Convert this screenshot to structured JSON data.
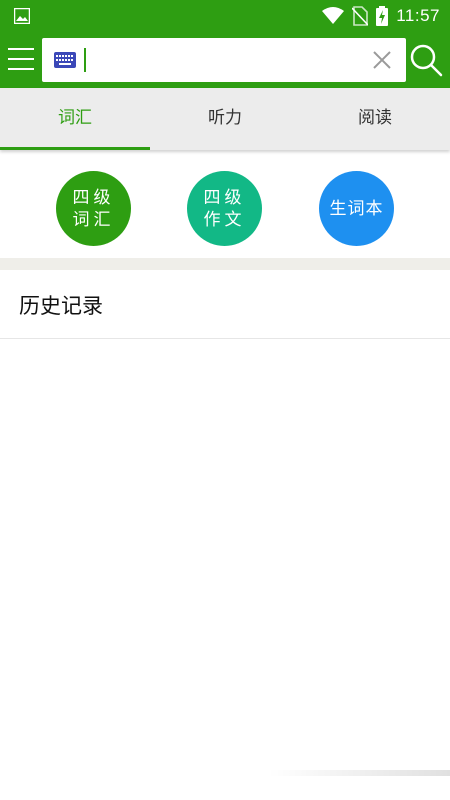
{
  "status_bar": {
    "time": "11:57",
    "icons": [
      "gallery-icon",
      "wifi-icon",
      "no-sim-icon",
      "battery-charging-icon"
    ]
  },
  "app_bar": {
    "search": {
      "value": "",
      "placeholder": ""
    },
    "icons": [
      "menu-icon",
      "keyboard-icon",
      "clear-icon",
      "search-icon"
    ]
  },
  "tabs": [
    {
      "label": "词汇",
      "active": true
    },
    {
      "label": "听力",
      "active": false
    },
    {
      "label": "阅读",
      "active": false
    }
  ],
  "quick_actions": [
    {
      "line1": "四级",
      "line2": "词汇",
      "color": "#2e9e12"
    },
    {
      "line1": "四级",
      "line2": "作文",
      "color": "#12b886"
    },
    {
      "line1": "生词本",
      "line2": "",
      "color": "#1e90f0"
    }
  ],
  "history": {
    "title": "历史记录"
  },
  "colors": {
    "primary": "#2e9e12",
    "teal": "#12b886",
    "blue": "#1e90f0",
    "background": "#ffffff"
  }
}
